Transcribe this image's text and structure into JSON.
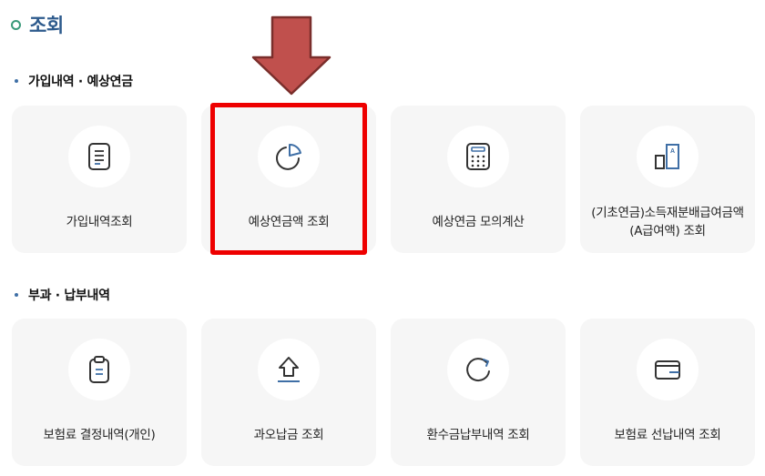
{
  "page": {
    "title": "조회"
  },
  "sections": [
    {
      "heading": "가입내역 · 예상연금",
      "cards": [
        {
          "label": "가입내역조회",
          "icon": "document-list-icon"
        },
        {
          "label": "예상연금액 조회",
          "icon": "pie-chart-icon"
        },
        {
          "label": "예상연금 모의계산",
          "icon": "calculator-icon"
        },
        {
          "label": "(기초연금)소득재분배급여금액(A급여액) 조회",
          "icon": "bar-document-icon"
        }
      ]
    },
    {
      "heading": "부과 · 납부내역",
      "cards": [
        {
          "label": "보험료 결정내역(개인)",
          "icon": "clipboard-icon"
        },
        {
          "label": "과오납금 조회",
          "icon": "upload-arrow-icon"
        },
        {
          "label": "환수금납부내역 조회",
          "icon": "refresh-icon"
        },
        {
          "label": "보험료 선납내역 조회",
          "icon": "wallet-icon"
        }
      ]
    }
  ],
  "annotations": {
    "highlight_color": "#ee0000",
    "arrow_color": "#c0504d"
  },
  "colors": {
    "title": "#2d5a8c",
    "ring": "#3a9a7a",
    "icon_stroke": "#333333",
    "icon_accent": "#3f6fa6"
  }
}
